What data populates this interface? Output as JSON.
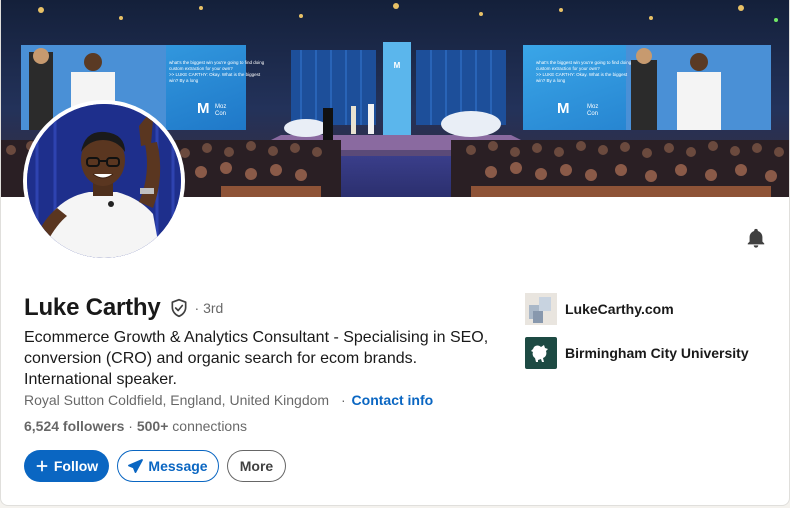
{
  "profile": {
    "name": "Luke Carthy",
    "degree": "· 3rd",
    "headline": "Ecommerce Growth & Analytics Consultant - Specialising in SEO, conversion (CRO) and organic search for ecom brands. International speaker.",
    "location": "Royal Sutton Coldfield, England, United Kingdom",
    "separator": "·",
    "contact_label": "Contact info",
    "followers": "6,524 followers",
    "stats_separator": " · ",
    "connections_count": "500+",
    "connections_label": " connections"
  },
  "actions": {
    "follow_label": "Follow",
    "message_label": "Message",
    "more_label": "More"
  },
  "entities": [
    {
      "label": "LukeCarthy.com",
      "icon": "company-logo-icon"
    },
    {
      "label": "Birmingham City University",
      "icon": "university-crest-icon"
    }
  ],
  "banner": {
    "screen_brand": "Moz",
    "screen_brand_line2": "Con",
    "screen_caption_1": "what's the biggest win you're going to find doing",
    "screen_caption_2": "custom extraction for your own?",
    "screen_caption_3": ">> LUKE CARTHY: Okay. What is the biggest",
    "screen_caption_4": "win? By a long"
  },
  "icons": {
    "bell": "bell-icon",
    "verified": "verified-shield-icon",
    "follow": "plus-icon",
    "message": "send-icon"
  },
  "colors": {
    "accent": "#0a66c2",
    "university_bg": "#1d4a43"
  }
}
